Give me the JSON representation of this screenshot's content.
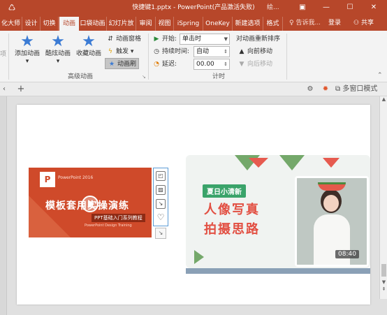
{
  "titlebar": {
    "app_icon": "powerpoint-save-icon",
    "title": "快捷键1.pptx - PowerPoint(产品激活失败)",
    "extra": "绘...",
    "buttons": [
      "▣",
      "—",
      "☐",
      "✕"
    ]
  },
  "tabs": {
    "items": [
      "化大师",
      "设计",
      "切换",
      "动画",
      "口袋动画",
      "幻灯片放",
      "审阅",
      "视图",
      "iSpring",
      "OneKey",
      "新建选项",
      "格式"
    ],
    "active": "动画",
    "tell_me": "告诉我...",
    "login": "登录",
    "share": "共享"
  },
  "ribbon": {
    "advanced_group": {
      "add": "添加动画",
      "cool": "酷炫动画",
      "fav": "收藏动画",
      "pane": "动画窗格",
      "trigger": "触发",
      "painter": "动画刷",
      "label": "高级动画"
    },
    "timing_group": {
      "start_label": "开始:",
      "start_value": "单击时",
      "duration_label": "持续时间:",
      "duration_value": "自动",
      "delay_label": "延迟:",
      "delay_value": "00.00",
      "reorder": "对动画重新排序",
      "forward": "向前移动",
      "backward": "向后移动",
      "label": "计时"
    }
  },
  "strip": {
    "multi_window": "多窗口模式"
  },
  "slide": {
    "card_left": {
      "logo": "P",
      "version": "PowerPoint 2016",
      "title": "模板套用实操演练",
      "subtitle": "PPT基础入门系列教程",
      "foot": "PowerPoint Design Training"
    },
    "card_right": {
      "badge": "夏日小清新",
      "line1": "人像写真",
      "line2": "拍摄思路",
      "duration": "08:40"
    }
  }
}
